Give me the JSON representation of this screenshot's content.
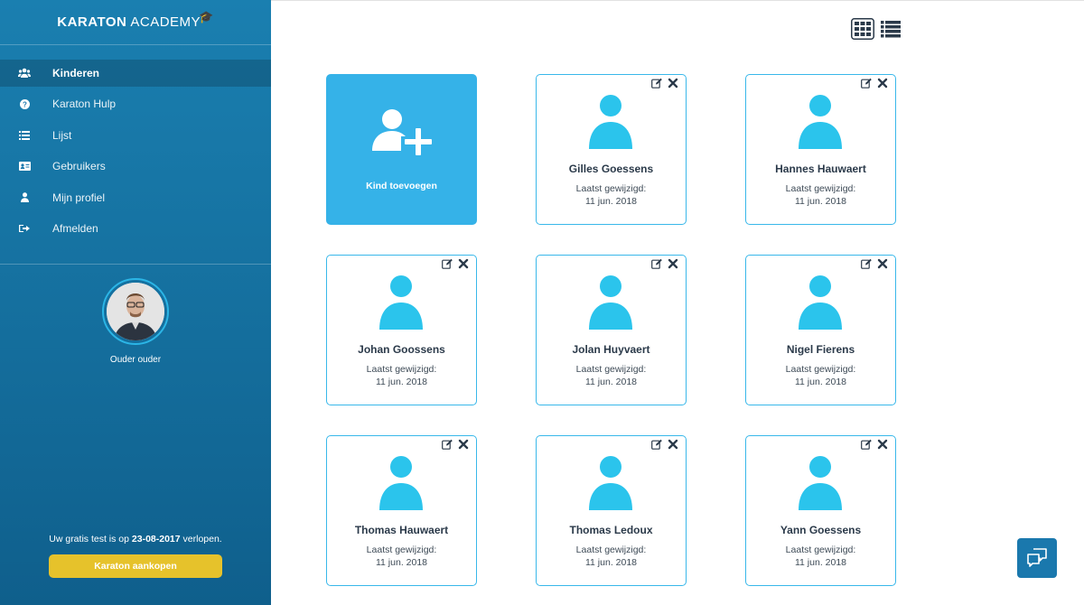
{
  "brand": {
    "part1": "KARATON",
    "part2": "ACADEMY"
  },
  "menu": [
    {
      "label": "Kinderen",
      "icon": "users-icon",
      "active": true
    },
    {
      "label": "Karaton Hulp",
      "icon": "help-icon",
      "active": false
    },
    {
      "label": "Lijst",
      "icon": "list-icon",
      "active": false
    },
    {
      "label": "Gebruikers",
      "icon": "id-card-icon",
      "active": false
    },
    {
      "label": "Mijn profiel",
      "icon": "user-icon",
      "active": false
    },
    {
      "label": "Afmelden",
      "icon": "sign-out-icon",
      "active": false
    }
  ],
  "profile": {
    "name": "Ouder ouder"
  },
  "trial": {
    "prefix": "Uw gratis test is op ",
    "date": "23-08-2017",
    "suffix": " verlopen."
  },
  "buy_button": "Karaton aankopen",
  "add_card": {
    "label": "Kind toevoegen"
  },
  "children": [
    {
      "name": "Gilles Goessens",
      "label": "Laatst gewijzigd:",
      "date": "11 jun. 2018"
    },
    {
      "name": "Hannes Hauwaert",
      "label": "Laatst gewijzigd:",
      "date": "11 jun. 2018"
    },
    {
      "name": "Johan Goossens",
      "label": "Laatst gewijzigd:",
      "date": "11 jun. 2018"
    },
    {
      "name": "Jolan Huyvaert",
      "label": "Laatst gewijzigd:",
      "date": "11 jun. 2018"
    },
    {
      "name": "Nigel Fierens",
      "label": "Laatst gewijzigd:",
      "date": "11 jun. 2018"
    },
    {
      "name": "Thomas Hauwaert",
      "label": "Laatst gewijzigd:",
      "date": "11 jun. 2018"
    },
    {
      "name": "Thomas Ledoux",
      "label": "Laatst gewijzigd:",
      "date": "11 jun. 2018"
    },
    {
      "name": "Yann Goessens",
      "label": "Laatst gewijzigd:",
      "date": "11 jun. 2018"
    }
  ],
  "colors": {
    "sidebar_top": "#1a7fb0",
    "sidebar_bottom": "#0f5f8c",
    "accent": "#35b2e8",
    "person_icon": "#2bc4ec",
    "buy_button": "#e6c22b",
    "chat_button": "#1a78ad"
  }
}
